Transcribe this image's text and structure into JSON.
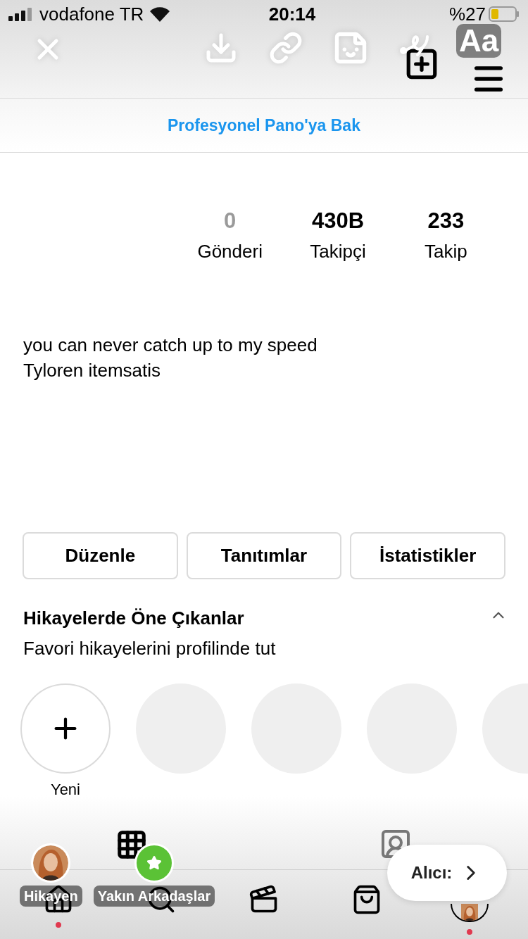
{
  "status_bar": {
    "carrier": "vodafone TR",
    "time": "20:14",
    "battery": "%27"
  },
  "editor_toolbar": {
    "text_tool": "Aa"
  },
  "banner": {
    "link": "Profesyonel Pano'ya Bak"
  },
  "stats": [
    {
      "value": "0",
      "label": "Gönderi",
      "dimmed": true
    },
    {
      "value": "430B",
      "label": "Takipçi",
      "dimmed": false
    },
    {
      "value": "233",
      "label": "Takip",
      "dimmed": false
    }
  ],
  "bio": [
    "you can never catch up to my speed",
    "Tyloren itemsatis"
  ],
  "buttons": [
    "Düzenle",
    "Tanıtımlar",
    "İstatistikler"
  ],
  "highlights": {
    "title": "Hikayelerde Öne Çıkanlar",
    "subtitle": "Favori hikayelerini profilinde tut",
    "expanded": true,
    "items": [
      {
        "kind": "new",
        "label": "Yeni"
      },
      {
        "kind": "empty"
      },
      {
        "kind": "empty"
      },
      {
        "kind": "empty"
      },
      {
        "kind": "empty"
      }
    ]
  },
  "share_targets": [
    {
      "kind": "avatar",
      "label": "Hikayen"
    },
    {
      "kind": "close_friends",
      "label": "Yakın Arkadaşlar"
    }
  ],
  "recipient_button": {
    "label": "Alıcı:"
  },
  "nav": [
    {
      "kind": "home",
      "dot": true
    },
    {
      "kind": "search",
      "dot": false
    },
    {
      "kind": "reels",
      "dot": false
    },
    {
      "kind": "shop",
      "dot": false
    },
    {
      "kind": "profile",
      "dot": true
    }
  ]
}
